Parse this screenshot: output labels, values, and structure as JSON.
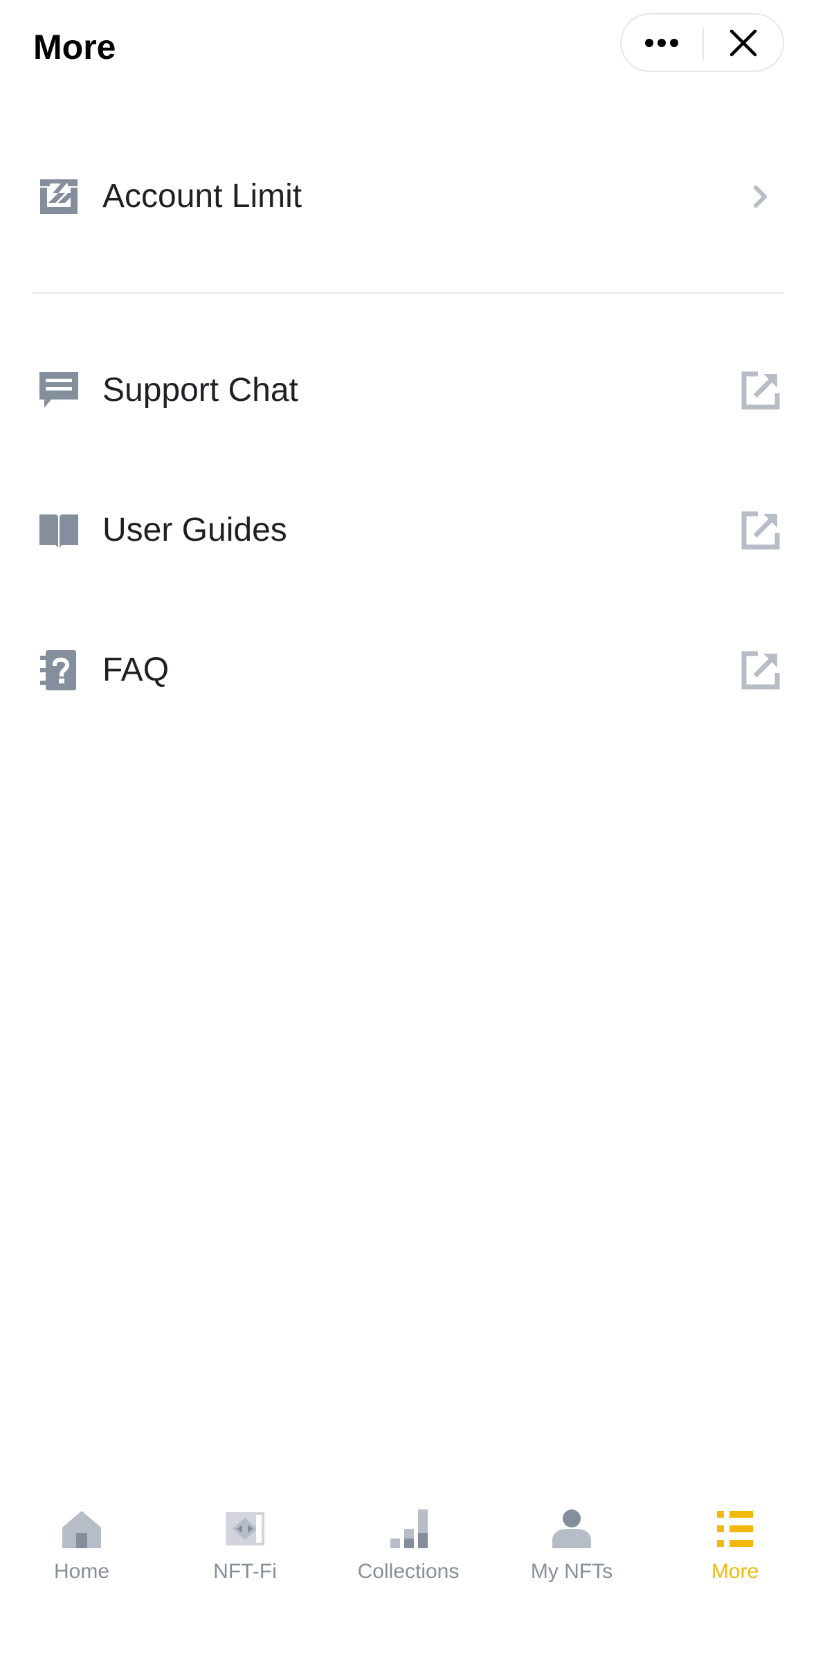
{
  "header": {
    "title": "More",
    "more_icon": "ellipsis-icon",
    "close_icon": "close-icon"
  },
  "menu": {
    "section1": [
      {
        "label": "Account Limit",
        "icon": "account-limit-icon",
        "trail": "chevron-right-icon"
      }
    ],
    "section2": [
      {
        "label": "Support Chat",
        "icon": "chat-icon",
        "trail": "external-link-icon"
      },
      {
        "label": "User Guides",
        "icon": "book-icon",
        "trail": "external-link-icon"
      },
      {
        "label": "FAQ",
        "icon": "faq-icon",
        "trail": "external-link-icon"
      }
    ]
  },
  "tabbar": {
    "tabs": [
      {
        "label": "Home",
        "icon": "home-icon",
        "active": false
      },
      {
        "label": "NFT-Fi",
        "icon": "nft-fi-icon",
        "active": false
      },
      {
        "label": "Collections",
        "icon": "collections-icon",
        "active": false
      },
      {
        "label": "My NFTs",
        "icon": "user-icon",
        "active": false
      },
      {
        "label": "More",
        "icon": "list-icon",
        "active": true
      }
    ]
  },
  "colors": {
    "accent": "#f0b90b",
    "icon_gray": "#848e9c",
    "text": "#1e2026",
    "muted_icon": "#b7bdc6"
  }
}
